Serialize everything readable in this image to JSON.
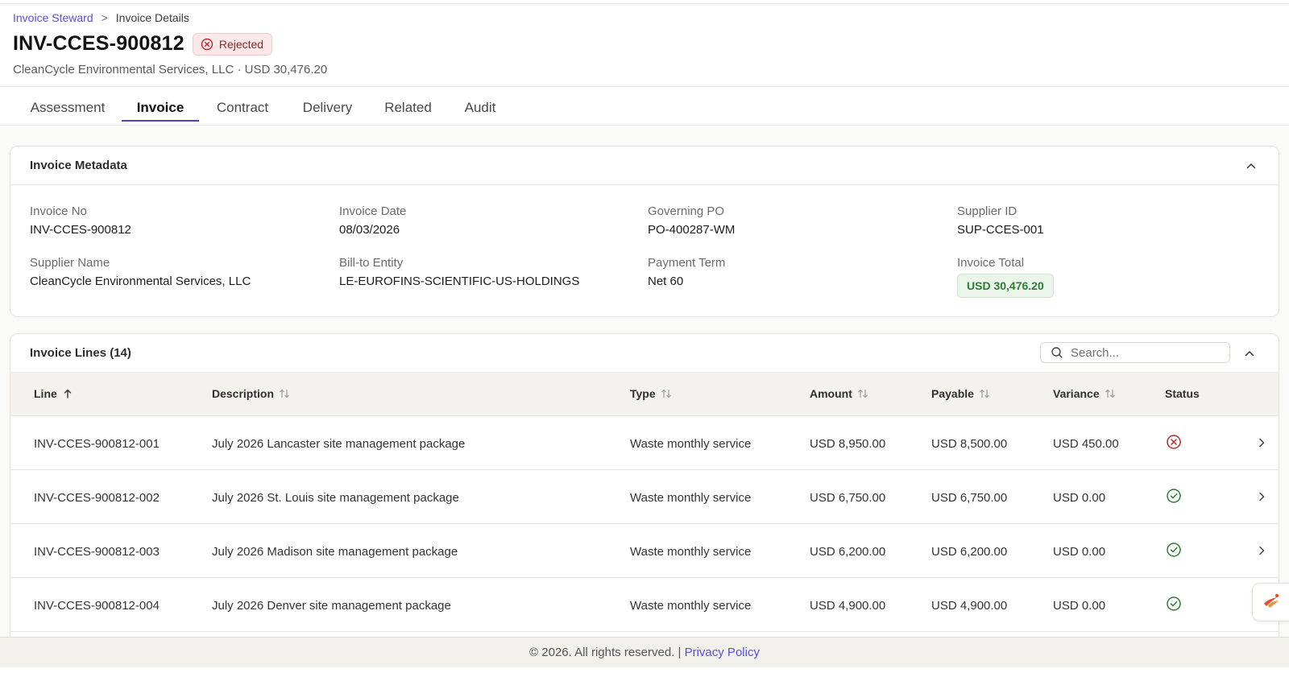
{
  "breadcrumb": {
    "root": "Invoice Steward",
    "separator": ">",
    "current": "Invoice Details"
  },
  "header": {
    "title": "INV-CCES-900812",
    "status": "Rejected",
    "subtitle": "CleanCycle Environmental Services, LLC · USD 30,476.20"
  },
  "tabs": [
    "Assessment",
    "Invoice",
    "Contract",
    "Delivery",
    "Related",
    "Audit"
  ],
  "active_tab": "Invoice",
  "metadata": {
    "title": "Invoice Metadata",
    "fields": [
      {
        "label": "Invoice No",
        "value": "INV-CCES-900812"
      },
      {
        "label": "Invoice Date",
        "value": "08/03/2026"
      },
      {
        "label": "Governing PO",
        "value": "PO-400287-WM"
      },
      {
        "label": "Supplier ID",
        "value": "SUP-CCES-001"
      },
      {
        "label": "Supplier Name",
        "value": "CleanCycle Environmental Services, LLC"
      },
      {
        "label": "Bill-to Entity",
        "value": "LE-EUROFINS-SCIENTIFIC-US-HOLDINGS"
      },
      {
        "label": "Payment Term",
        "value": "Net 60"
      },
      {
        "label": "Invoice Total",
        "value": "USD 30,476.20"
      }
    ]
  },
  "lines": {
    "title": "Invoice Lines (14)",
    "search_placeholder": "Search...",
    "columns": [
      "Line",
      "Description",
      "Type",
      "Amount",
      "Payable",
      "Variance",
      "Status"
    ],
    "rows": [
      {
        "line": "INV-CCES-900812-001",
        "description": "July 2026 Lancaster site management package",
        "type": "Waste monthly service",
        "amount": "USD 8,950.00",
        "payable": "USD 8,500.00",
        "variance": "USD 450.00",
        "status": "rejected"
      },
      {
        "line": "INV-CCES-900812-002",
        "description": "July 2026 St. Louis site management package",
        "type": "Waste monthly service",
        "amount": "USD 6,750.00",
        "payable": "USD 6,750.00",
        "variance": "USD 0.00",
        "status": "approved"
      },
      {
        "line": "INV-CCES-900812-003",
        "description": "July 2026 Madison site management package",
        "type": "Waste monthly service",
        "amount": "USD 6,200.00",
        "payable": "USD 6,200.00",
        "variance": "USD 0.00",
        "status": "approved"
      },
      {
        "line": "INV-CCES-900812-004",
        "description": "July 2026 Denver site management package",
        "type": "Waste monthly service",
        "amount": "USD 4,900.00",
        "payable": "USD 4,900.00",
        "variance": "USD 0.00",
        "status": "approved"
      }
    ]
  },
  "footer": {
    "copyright": "© 2026. All rights reserved. | ",
    "privacy": "Privacy Policy"
  },
  "colors": {
    "accent": "#5b4fd9",
    "rejected": "#b42b2b",
    "approved": "#2e7d32"
  }
}
